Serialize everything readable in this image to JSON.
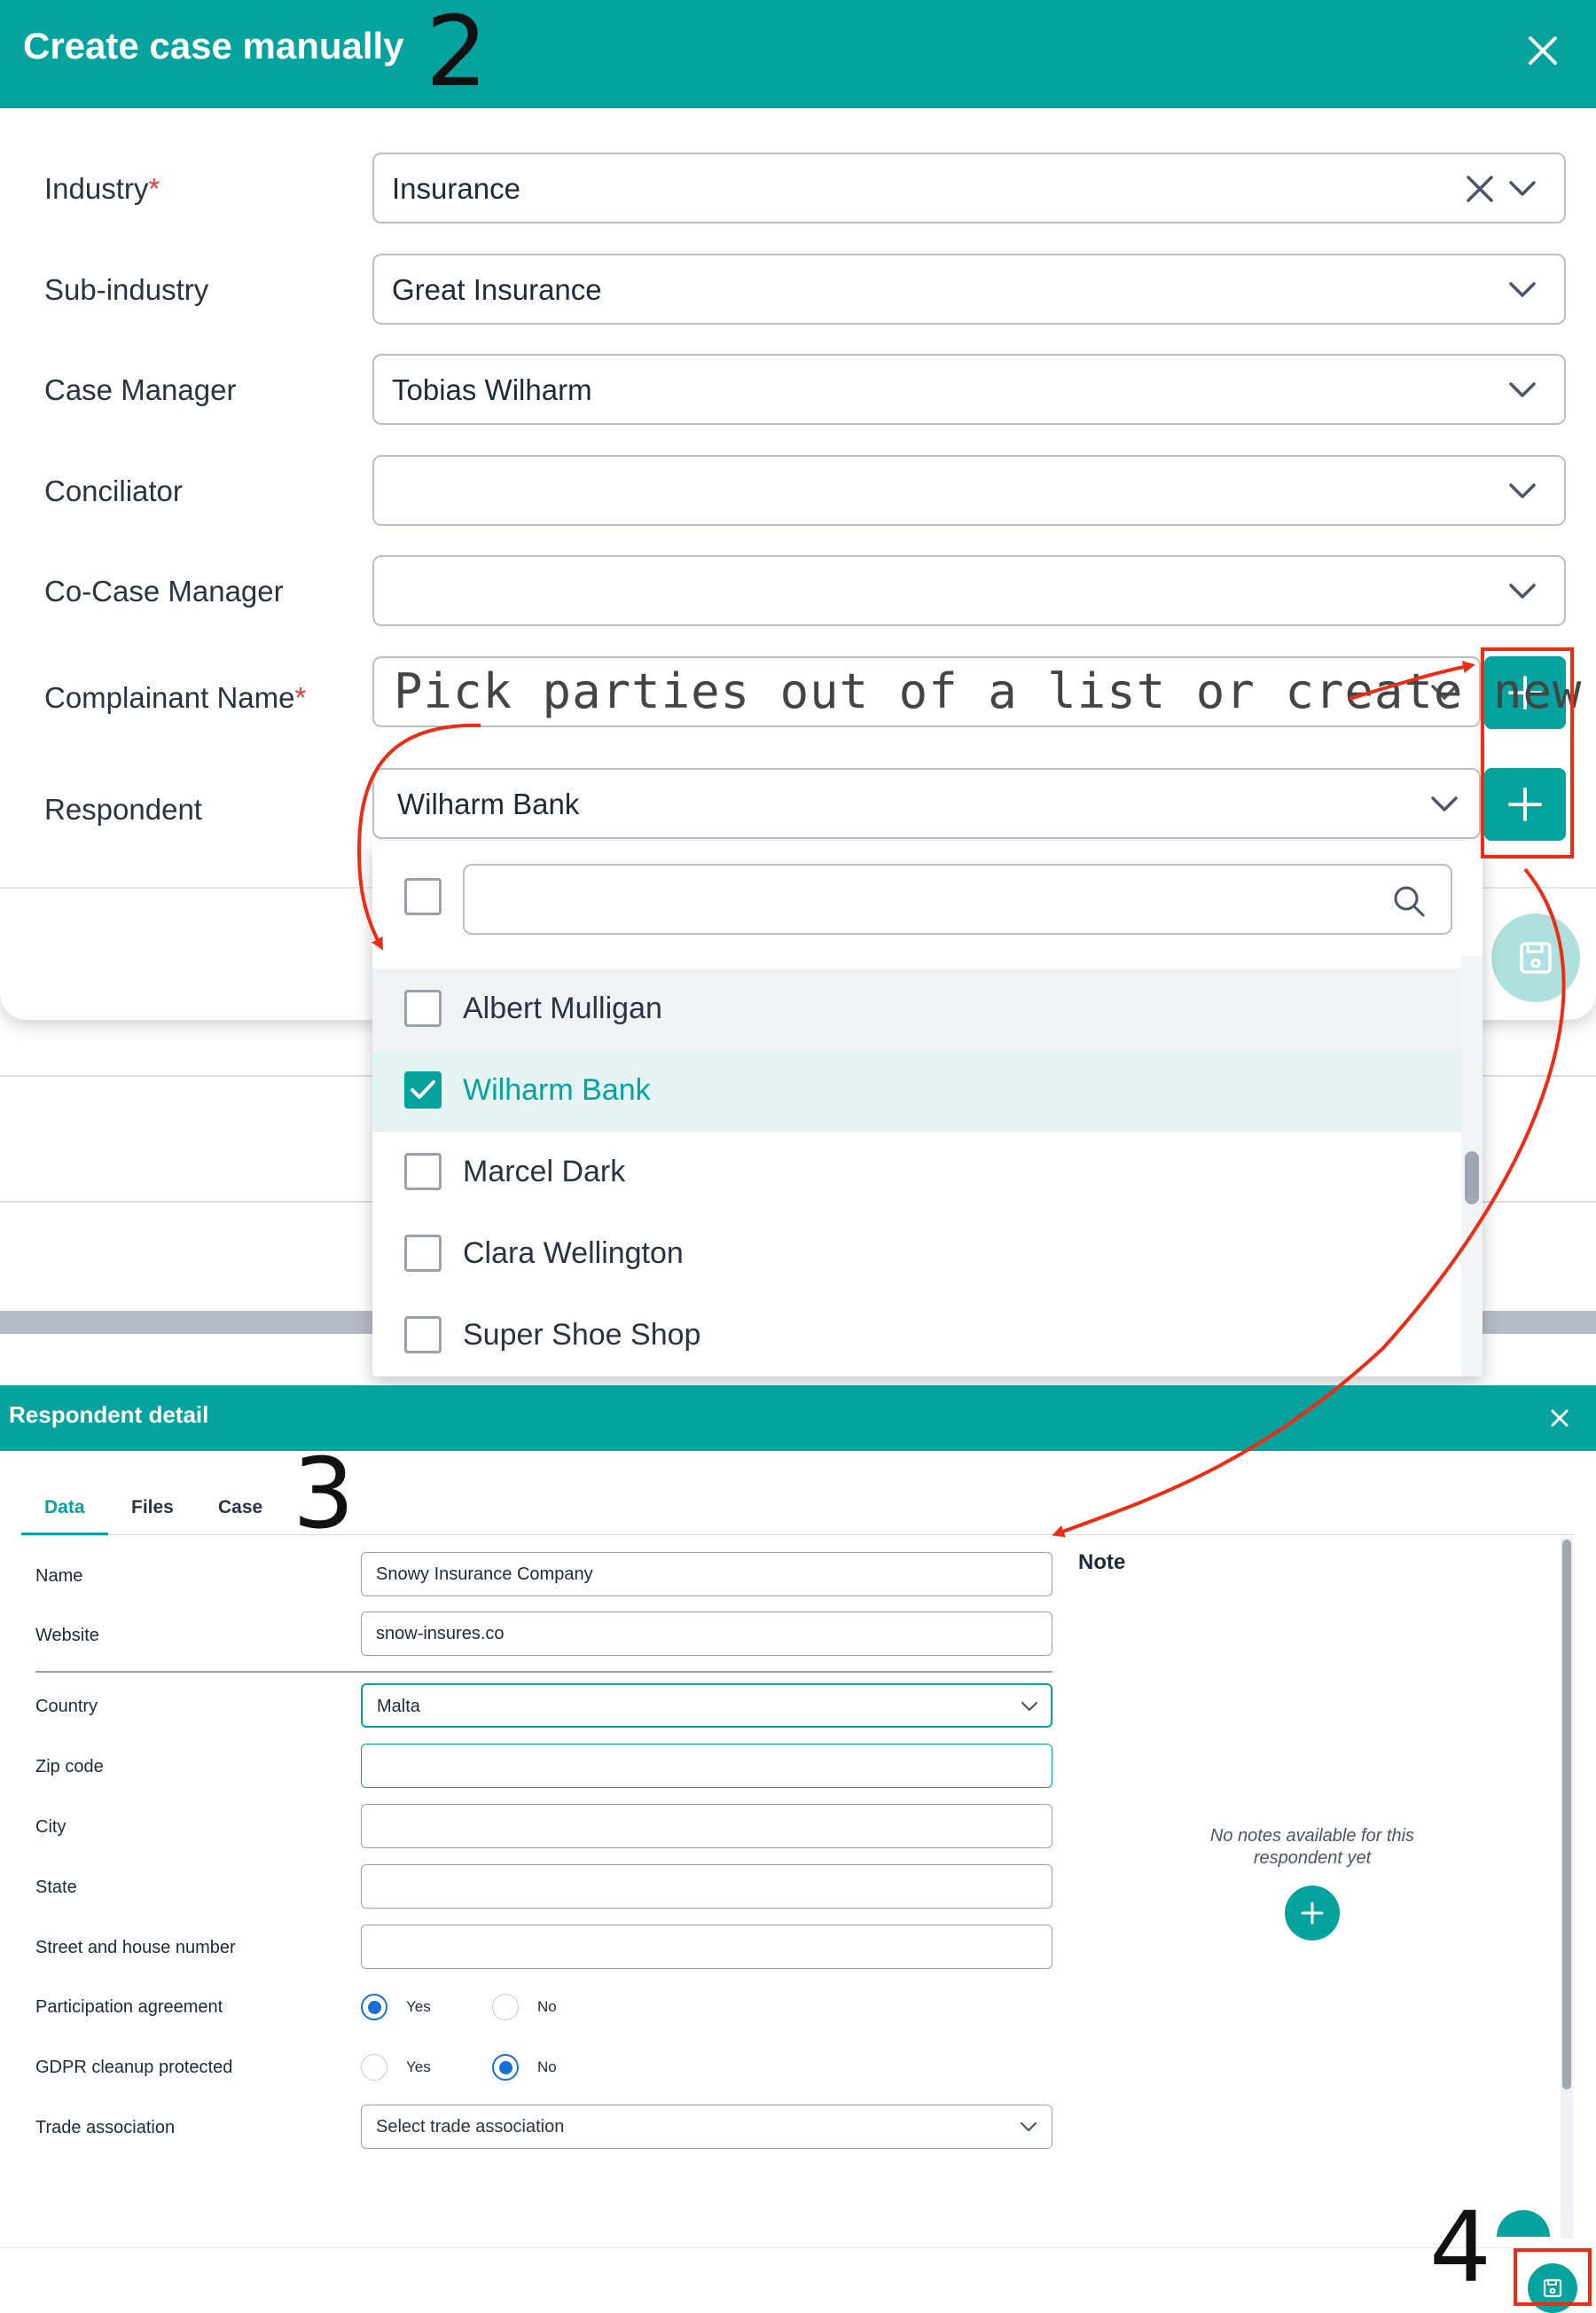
{
  "modal1": {
    "title": "Create case manually",
    "step_number": "2",
    "fields": {
      "industry": {
        "label": "Industry",
        "required_mark": "*",
        "value": "Insurance"
      },
      "sub_industry": {
        "label": "Sub-industry",
        "value": "Great Insurance"
      },
      "case_manager": {
        "label": "Case Manager",
        "value": "Tobias Wilharm"
      },
      "conciliator": {
        "label": "Conciliator",
        "value": ""
      },
      "co_case_manager": {
        "label": "Co-Case Manager",
        "value": ""
      },
      "complainant": {
        "label": "Complainant Name",
        "required_mark": "*",
        "value": ""
      },
      "respondent": {
        "label": "Respondent",
        "value": "Wilharm Bank"
      }
    },
    "annotation": "Pick parties out of a list or create new"
  },
  "dropdown": {
    "search_value": "",
    "options": [
      {
        "label": "Albert Mulligan",
        "checked": false
      },
      {
        "label": "Wilharm Bank",
        "checked": true
      },
      {
        "label": "Marcel Dark",
        "checked": false
      },
      {
        "label": "Clara Wellington",
        "checked": false
      },
      {
        "label": "Super Shoe Shop",
        "checked": false
      }
    ]
  },
  "modal2": {
    "title": "Respondent detail",
    "step_number": "3",
    "tabs": [
      {
        "label": "Data",
        "active": true
      },
      {
        "label": "Files",
        "active": false
      },
      {
        "label": "Case",
        "active": false
      }
    ],
    "fields": {
      "name": {
        "label": "Name",
        "value": "Snowy Insurance Company"
      },
      "website": {
        "label": "Website",
        "value": "snow-insures.co"
      },
      "country": {
        "label": "Country",
        "value": "Malta"
      },
      "zip": {
        "label": "Zip code",
        "value": ""
      },
      "city": {
        "label": "City",
        "value": ""
      },
      "state": {
        "label": "State",
        "value": ""
      },
      "street": {
        "label": "Street and house number",
        "value": ""
      },
      "participation": {
        "label": "Participation agreement",
        "yes": "Yes",
        "no": "No",
        "selected": "Yes"
      },
      "gdpr": {
        "label": "GDPR cleanup protected",
        "yes": "Yes",
        "no": "No",
        "selected": "No"
      },
      "trade": {
        "label": "Trade association",
        "placeholder": "Select trade association"
      }
    },
    "note": {
      "title": "Note",
      "empty_text": "No notes available for this respondent yet"
    },
    "save_step_number": "4"
  },
  "colors": {
    "brand": "#05a39d",
    "annotation_red": "#ef2b14",
    "radio_blue": "#1a6fd6"
  }
}
